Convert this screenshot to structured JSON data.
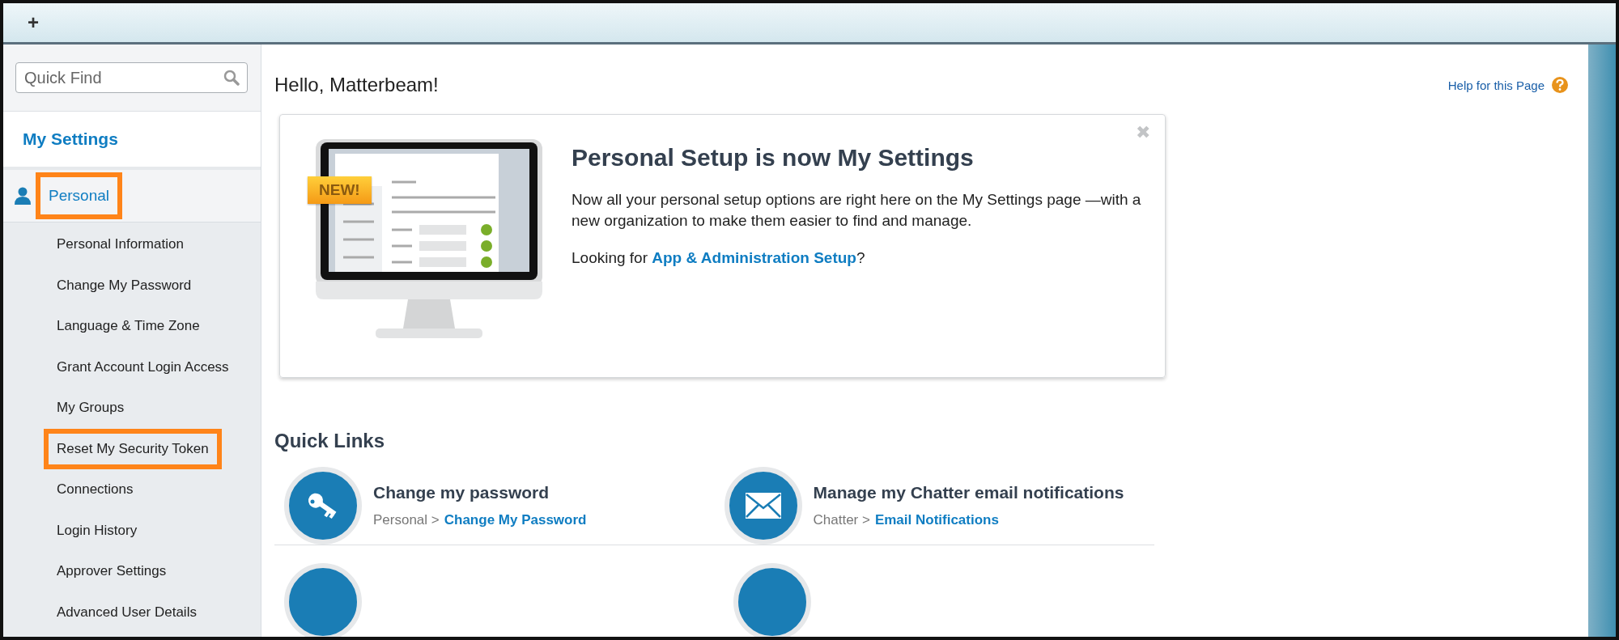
{
  "top_bar": {
    "add_button": "+"
  },
  "sidebar": {
    "search": {
      "placeholder": "Quick Find"
    },
    "heading": "My Settings",
    "section": {
      "label": "Personal",
      "highlighted": true,
      "items": [
        {
          "label": "Personal Information",
          "highlighted": false
        },
        {
          "label": "Change My Password",
          "highlighted": false
        },
        {
          "label": "Language & Time Zone",
          "highlighted": false
        },
        {
          "label": "Grant Account Login Access",
          "highlighted": false
        },
        {
          "label": "My Groups",
          "highlighted": false
        },
        {
          "label": "Reset My Security Token",
          "highlighted": true
        },
        {
          "label": "Connections",
          "highlighted": false
        },
        {
          "label": "Login History",
          "highlighted": false
        },
        {
          "label": "Approver Settings",
          "highlighted": false
        },
        {
          "label": "Advanced User Details",
          "highlighted": false
        }
      ]
    }
  },
  "main": {
    "greeting": "Hello, Matterbeam!",
    "help_link": "Help for this Page",
    "banner": {
      "badge": "NEW!",
      "title": "Personal Setup is now My Settings",
      "text": "Now all your personal setup options are right here on the My Settings page —with a new organization to make them easier to find and manage.",
      "prompt": "Looking for",
      "link": "App & Administration Setup",
      "suffix": "?",
      "close": "✖"
    },
    "quick_links": {
      "title": "Quick Links",
      "items": [
        {
          "kind": "key",
          "title": "Change my password",
          "path": "Personal >",
          "link": "Change My Password"
        },
        {
          "kind": "mail",
          "title": "Manage my Chatter email notifications",
          "path": "Chatter >",
          "link": "Email Notifications"
        }
      ]
    }
  }
}
